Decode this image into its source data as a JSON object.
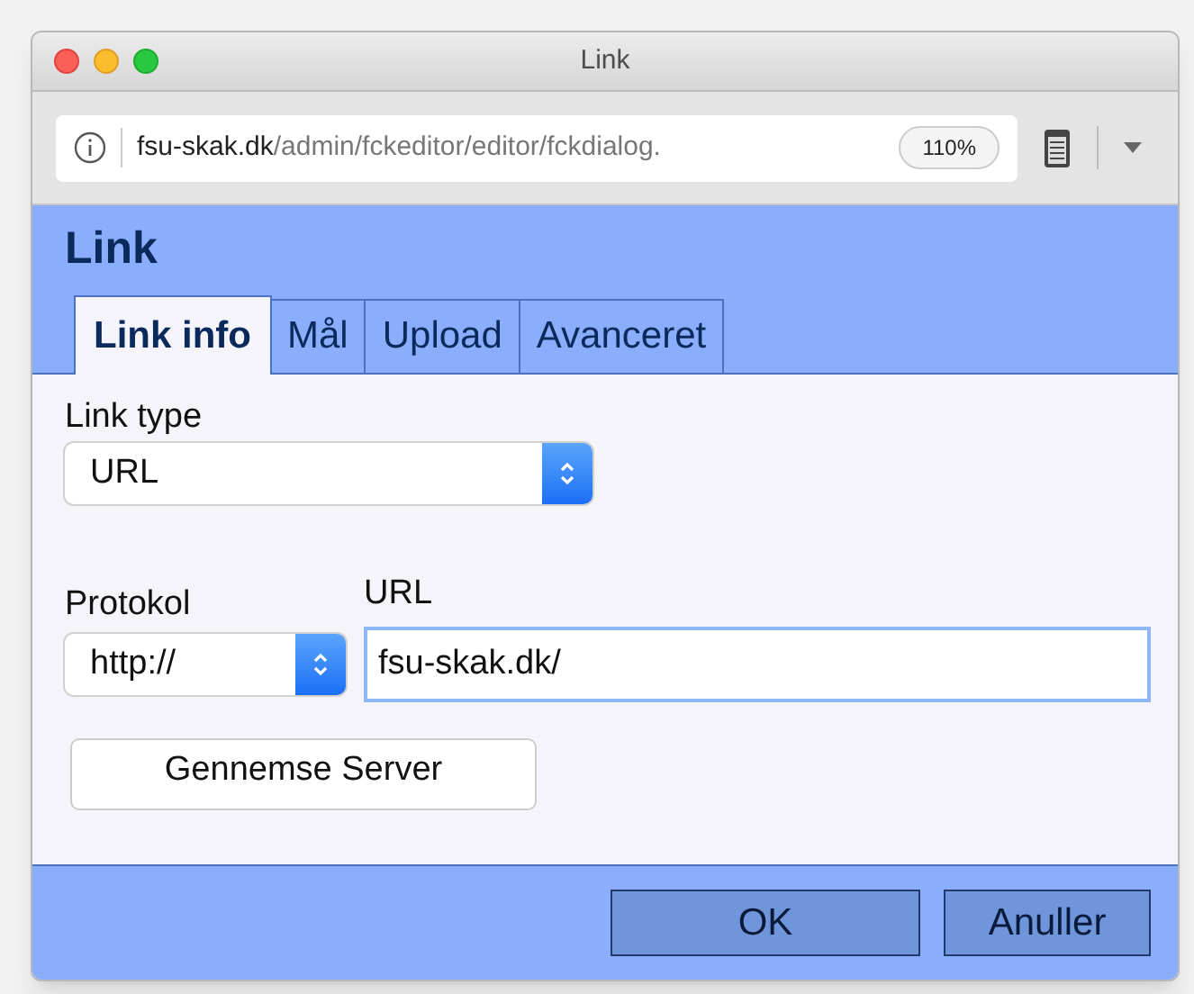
{
  "window": {
    "title": "Link"
  },
  "address_bar": {
    "domain": "fsu-skak.dk",
    "path": "/admin/fckeditor/editor/fckdialog.",
    "zoom": "110%"
  },
  "dialog": {
    "title": "Link",
    "tabs": [
      {
        "label": "Link info",
        "selected": true
      },
      {
        "label": "Mål",
        "selected": false
      },
      {
        "label": "Upload",
        "selected": false
      },
      {
        "label": "Avanceret",
        "selected": false
      }
    ],
    "link_type": {
      "label": "Link type",
      "value": "URL"
    },
    "protocol": {
      "label": "Protokol",
      "value": "http://"
    },
    "url": {
      "label": "URL",
      "value": "fsu-skak.dk/"
    },
    "browse_button": "Gennemse Server",
    "buttons": [
      "OK",
      "Anuller"
    ]
  }
}
